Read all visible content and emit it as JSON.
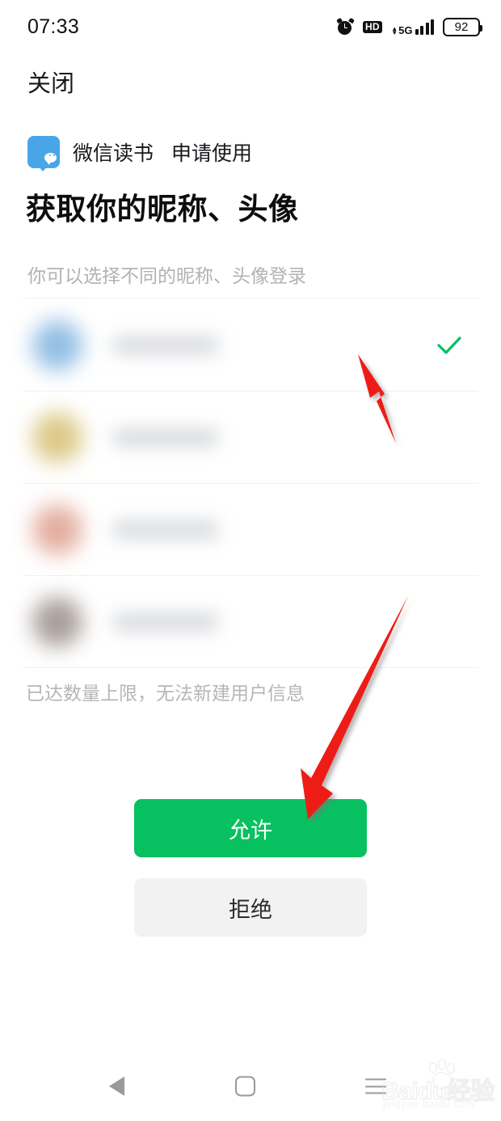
{
  "statusbar": {
    "time": "07:33",
    "alarm_icon": "alarm-clock-icon",
    "hd_label": "HD",
    "network_label": "5G",
    "signal_bars": 4,
    "battery_level": "92"
  },
  "header": {
    "close_label": "关闭"
  },
  "app": {
    "icon": "wechat-read-app-icon",
    "name": "微信读书",
    "action": "申请使用"
  },
  "permission": {
    "headline": "获取你的昵称、头像",
    "subtitle": "你可以选择不同的昵称、头像登录",
    "limit_hint": "已达数量上限，无法新建用户信息"
  },
  "accounts": {
    "rows": [
      {
        "avatar_color": "#7fb3e0",
        "selected": true,
        "check_icon": "check-icon"
      },
      {
        "avatar_color": "#d6bf72",
        "selected": false,
        "check_icon": ""
      },
      {
        "avatar_color": "#dfa08f",
        "selected": false,
        "check_icon": ""
      },
      {
        "avatar_color": "#9a8d88",
        "selected": false,
        "check_icon": ""
      }
    ]
  },
  "actions": {
    "allow_label": "允许",
    "reject_label": "拒绝"
  },
  "annotations": {
    "arrow_top": "red-arrow-pointing-to-selected-account",
    "arrow_bottom": "red-arrow-pointing-to-allow-button",
    "arrow_color": "#ee1c17"
  },
  "navbar": {
    "back": "back-triangle-icon",
    "home": "home-square-icon",
    "menu": "menu-hamburger-icon"
  },
  "watermark": {
    "brand": "Baidu经验",
    "url": "jingyan.baidu.com"
  },
  "colors": {
    "accent_green": "#07c160",
    "app_blue": "#48a6e8",
    "reject_gray": "#f2f2f2",
    "muted_text": "#b2b2b2"
  }
}
